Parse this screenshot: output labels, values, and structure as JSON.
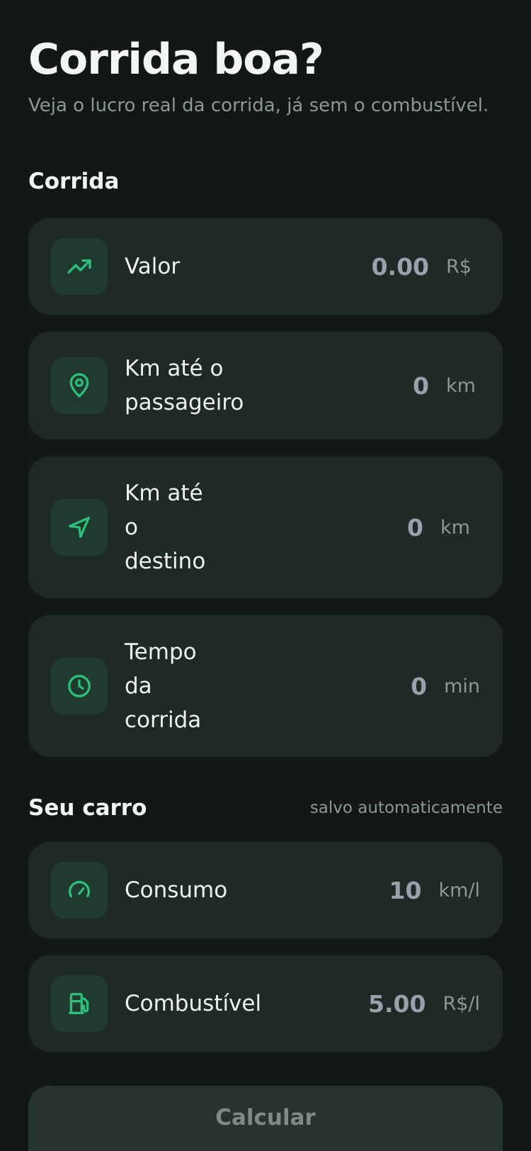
{
  "header": {
    "title": "Corrida boa?",
    "subtitle": "Veja o lucro real da corrida, já sem o combustível."
  },
  "ride_section": {
    "title": "Corrida",
    "fields": [
      {
        "label": "Valor",
        "value": "0.00",
        "unit": "R$",
        "icon": "trending-up-icon"
      },
      {
        "label": "Km até o passageiro",
        "value": "0",
        "unit": "km",
        "icon": "map-pin-icon"
      },
      {
        "label": "Km até o destino",
        "value": "0",
        "unit": "km",
        "icon": "navigation-icon"
      },
      {
        "label": "Tempo da corrida",
        "value": "0",
        "unit": "min",
        "icon": "clock-icon"
      }
    ]
  },
  "car_section": {
    "title": "Seu carro",
    "note": "salvo automaticamente",
    "fields": [
      {
        "label": "Consumo",
        "value": "10",
        "unit": "km/l",
        "icon": "gauge-icon"
      },
      {
        "label": "Combustível",
        "value": "5.00",
        "unit": "R$/l",
        "icon": "fuel-pump-icon"
      }
    ]
  },
  "actions": {
    "calculate_label": "Calcular"
  },
  "colors": {
    "background": "#121816",
    "card": "#1f2925",
    "icon_bg": "#1f3b2f",
    "accent": "#2fbd7c",
    "value_text": "#9aa1ab",
    "muted_text": "#8d9893"
  }
}
